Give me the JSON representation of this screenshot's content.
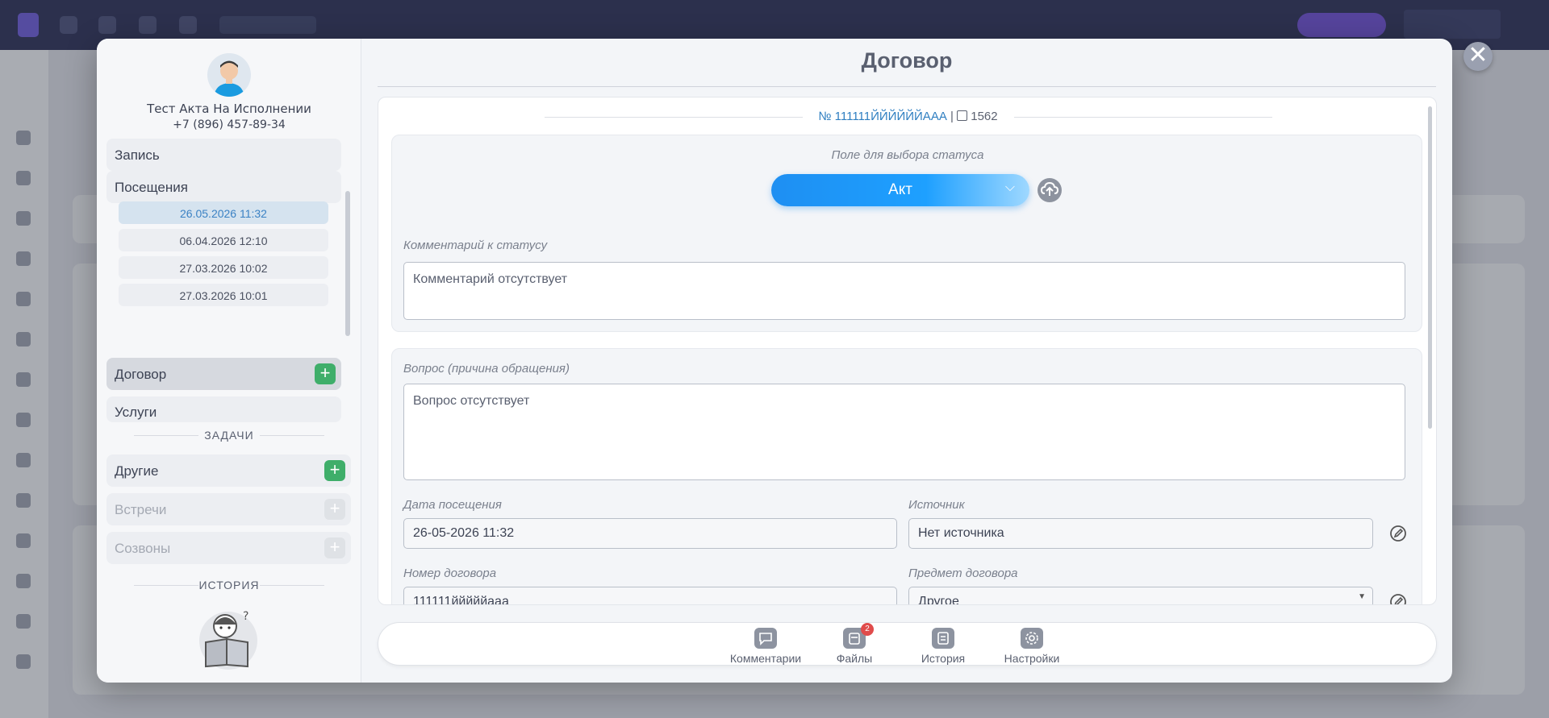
{
  "modal": {
    "title": "Договор",
    "close_glyph": "✕"
  },
  "patient": {
    "name": "Тест Акта На Исполнении",
    "phone": "+7 (896) 457-89-34"
  },
  "nav": {
    "record": "Запись",
    "visits": "Посещения",
    "visit_dates": [
      "26.05.2026 11:32",
      "06.04.2026 12:10",
      "27.03.2026 10:02",
      "27.03.2026 10:01"
    ],
    "contract": "Договор",
    "services": "Услуги"
  },
  "tasks": {
    "section_label": "ЗАДАЧИ",
    "items": [
      "Другие",
      "Встречи",
      "Созвоны"
    ]
  },
  "history": {
    "section_label": "ИСТОРИЯ"
  },
  "contract": {
    "number": "№ 111111ЙЙЙЙЙЙААА",
    "separator": "|",
    "id": "1562",
    "status_label": "Поле для выбора статуса",
    "status_value": "Акт",
    "status_comment_label": "Комментарий к статусу",
    "status_comment_value": "Комментарий отсутствует",
    "question_label": "Вопрос (причина обращения)",
    "question_value": "Вопрос отсутствует",
    "visit_date_label": "Дата посещения",
    "visit_date_value": "26-05-2026 11:32",
    "source_label": "Источник",
    "source_value": "Нет источника",
    "contract_number_label": "Номер договора",
    "contract_number_value": "111111йййййаaa",
    "subject_label": "Предмет договора",
    "subject_value": "Другое"
  },
  "toolbar": {
    "comments": "Комментарии",
    "files": "Файлы",
    "files_badge": "2",
    "history": "История",
    "settings": "Настройки"
  },
  "colors": {
    "accent": "#1e8ff2",
    "success": "#3fae6a",
    "badge": "#e04b4b",
    "link": "#2f7fc1"
  },
  "icons": [
    "avatar",
    "plus-icon",
    "upload-icon",
    "edit-icon",
    "comment-icon",
    "files-icon",
    "history-icon",
    "settings-icon",
    "close-icon",
    "chevron-down-icon"
  ]
}
